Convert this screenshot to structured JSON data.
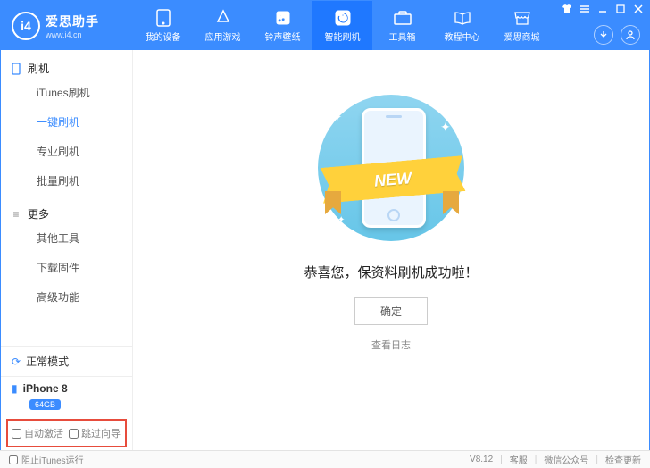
{
  "brand": {
    "name": "爱思助手",
    "url": "www.i4.cn",
    "logo_letters": "i4"
  },
  "header_tabs": [
    {
      "label": "我的设备"
    },
    {
      "label": "应用游戏"
    },
    {
      "label": "铃声壁纸"
    },
    {
      "label": "智能刷机"
    },
    {
      "label": "工具箱"
    },
    {
      "label": "教程中心"
    },
    {
      "label": "爱思商城"
    }
  ],
  "sidebar": {
    "group1_title": "刷机",
    "group1_items": [
      {
        "label": "iTunes刷机",
        "selected": false
      },
      {
        "label": "一键刷机",
        "selected": true
      },
      {
        "label": "专业刷机",
        "selected": false
      },
      {
        "label": "批量刷机",
        "selected": false
      }
    ],
    "group2_title": "更多",
    "group2_items": [
      {
        "label": "其他工具"
      },
      {
        "label": "下载固件"
      },
      {
        "label": "高级功能"
      }
    ],
    "mode": "正常模式",
    "device_name": "iPhone 8",
    "device_storage": "64GB",
    "opt_auto_activate": "自动激活",
    "opt_skip_guide": "跳过向导"
  },
  "content": {
    "ribbon": "NEW",
    "success_msg": "恭喜您，保资料刷机成功啦！",
    "ok_btn": "确定",
    "view_log": "查看日志"
  },
  "footer": {
    "block_itunes": "阻止iTunes运行",
    "version": "V8.12",
    "service": "客服",
    "wechat": "微信公众号",
    "check_update": "检查更新"
  }
}
